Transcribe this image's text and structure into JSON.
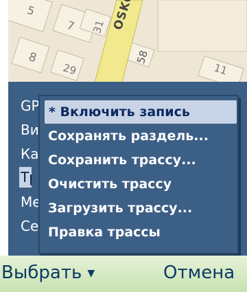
{
  "map": {
    "street_name": "OSKOVS",
    "house_numbers": [
      "5",
      "7",
      "31",
      "58",
      "8",
      "29",
      "11"
    ]
  },
  "main_menu": {
    "items": [
      {
        "label": "GPS",
        "selected": false
      },
      {
        "label": "Вид",
        "selected": false
      },
      {
        "label": "Карта",
        "selected": false
      },
      {
        "label": "Трасса",
        "selected": true
      },
      {
        "label": "Метки",
        "selected": false
      },
      {
        "label": "Сервис",
        "selected": false
      }
    ]
  },
  "submenu": {
    "items": [
      {
        "label": "* Включить запись",
        "highlighted": true
      },
      {
        "label": "Сохранять раздель...",
        "highlighted": false
      },
      {
        "label": "Сохранить трассу...",
        "highlighted": false
      },
      {
        "label": "Очистить трассу",
        "highlighted": false
      },
      {
        "label": "Загрузить трассу...",
        "highlighted": false
      },
      {
        "label": "Правка трассы",
        "highlighted": false
      }
    ]
  },
  "softkeys": {
    "left": "Выбрать",
    "right": "Отмена"
  },
  "colors": {
    "menu_bg": "#3c5f86",
    "highlight_bg": "#c8d4e6",
    "softkey_bg": "#d6ebc4",
    "softkey_text": "#0c3a66"
  }
}
